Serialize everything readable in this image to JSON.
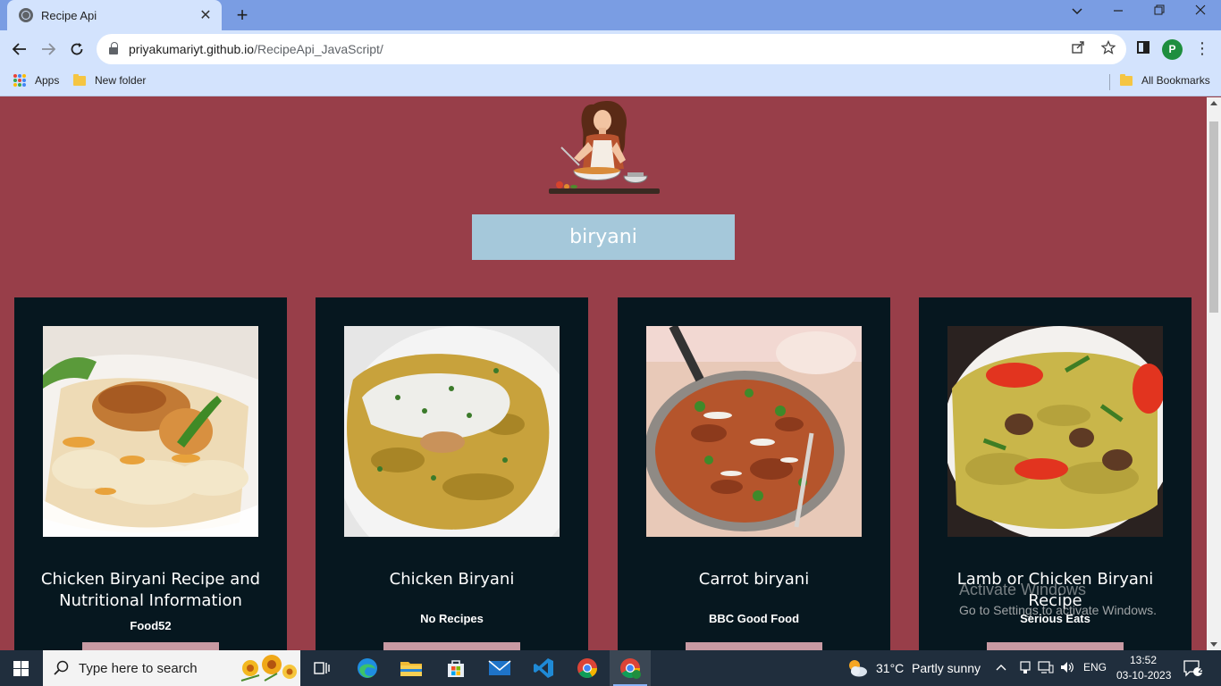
{
  "browser": {
    "tab_title": "Recipe Api",
    "tab_close": "✕",
    "new_tab": "+",
    "url_host": "priyakumariyt.github.io",
    "url_path": "/RecipeApi_JavaScript/",
    "profile_initial": "P",
    "bookmarks": {
      "apps": "Apps",
      "new_folder": "New folder",
      "all_bookmarks": "All Bookmarks"
    }
  },
  "search": {
    "value": "biryani"
  },
  "cards": [
    {
      "title": "Chicken Biryani Recipe and Nutritional Information",
      "source": "Food52"
    },
    {
      "title": "Chicken Biryani",
      "source": "No Recipes"
    },
    {
      "title": "Carrot biryani",
      "source": "BBC Good Food"
    },
    {
      "title": "Lamb or Chicken Biryani Recipe",
      "source": "Serious Eats"
    }
  ],
  "watermark": {
    "line1": "Activate Windows",
    "line2": "Go to Settings to activate Windows."
  },
  "taskbar": {
    "search_placeholder": "Type here to search",
    "temperature": "31°C",
    "weather": "Partly sunny",
    "language": "ENG",
    "time": "13:52",
    "date": "03-10-2023",
    "notification_count": "2"
  },
  "colors": {
    "page_background": "#983e49",
    "card_background": "#06171f",
    "search_background": "#a5c8da",
    "button_color": "#c89aa3"
  }
}
